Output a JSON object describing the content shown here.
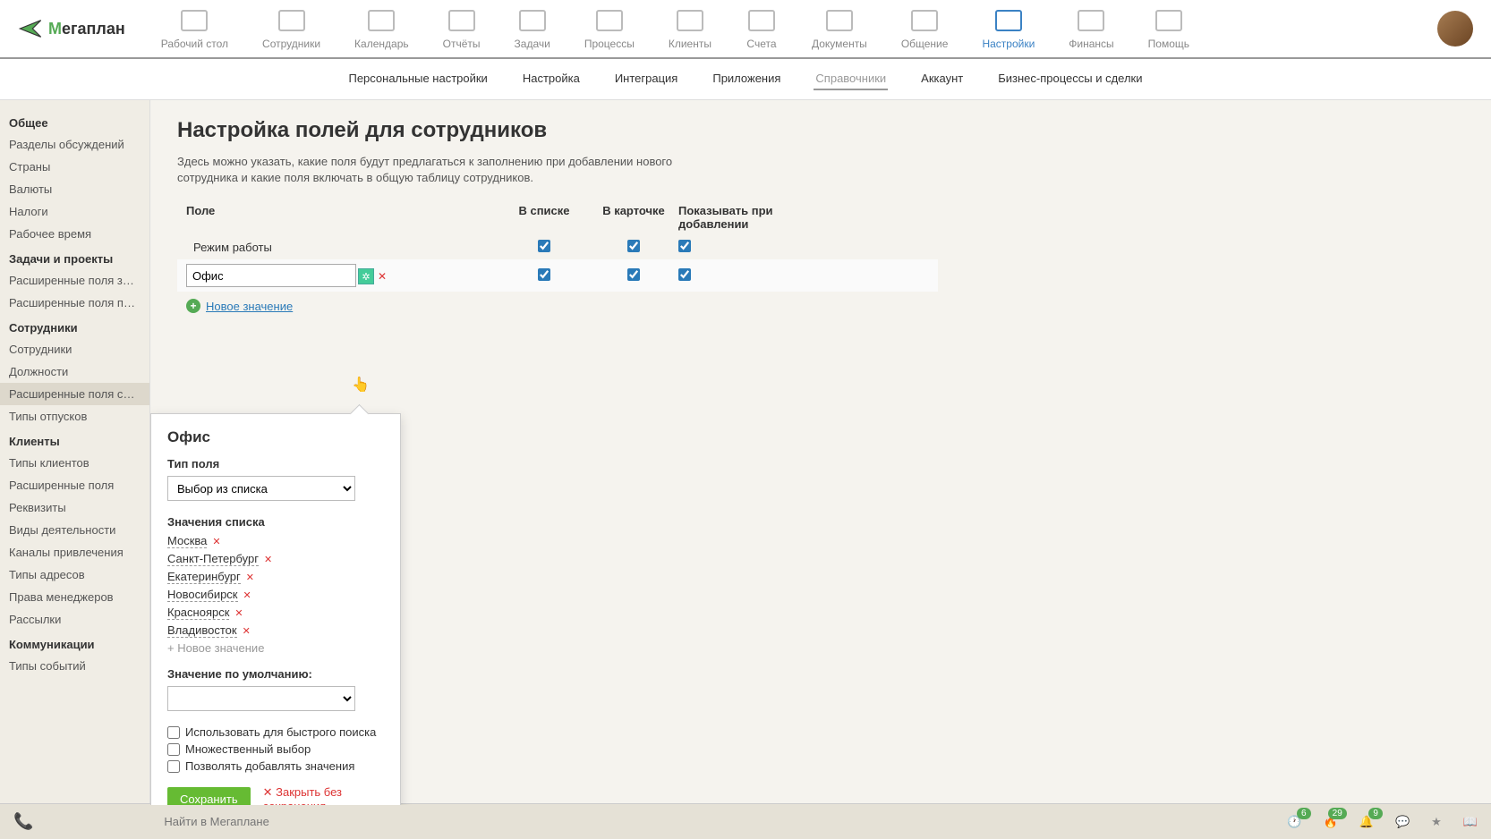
{
  "logo_text": "егаплан",
  "nav": [
    {
      "label": "Рабочий стол"
    },
    {
      "label": "Сотрудники"
    },
    {
      "label": "Календарь"
    },
    {
      "label": "Отчёты"
    },
    {
      "label": "Задачи"
    },
    {
      "label": "Процессы"
    },
    {
      "label": "Клиенты"
    },
    {
      "label": "Счета"
    },
    {
      "label": "Документы"
    },
    {
      "label": "Общение"
    },
    {
      "label": "Настройки",
      "active": true
    },
    {
      "label": "Финансы"
    },
    {
      "label": "Помощь"
    }
  ],
  "subtabs": [
    {
      "label": "Персональные настройки"
    },
    {
      "label": "Настройка"
    },
    {
      "label": "Интеграция"
    },
    {
      "label": "Приложения"
    },
    {
      "label": "Справочники",
      "active": true
    },
    {
      "label": "Аккаунт"
    },
    {
      "label": "Бизнес-процессы и сделки"
    }
  ],
  "sidebar": {
    "sections": [
      {
        "title": "Общее",
        "items": [
          "Разделы обсуждений",
          "Страны",
          "Валюты",
          "Налоги",
          "Рабочее время"
        ]
      },
      {
        "title": "Задачи и проекты",
        "items": [
          "Расширенные поля задач",
          "Расширенные поля проек..."
        ]
      },
      {
        "title": "Сотрудники",
        "items": [
          "Сотрудники",
          "Должности",
          "Расширенные поля сотру...",
          "Типы отпусков"
        ]
      },
      {
        "title": "Клиенты",
        "items": [
          "Типы клиентов",
          "Расширенные поля",
          "Реквизиты",
          "Виды деятельности",
          "Каналы привлечения",
          "Типы адресов",
          "Права менеджеров",
          "Рассылки"
        ]
      },
      {
        "title": "Коммуникации",
        "items": [
          "Типы событий"
        ]
      }
    ],
    "active": "Расширенные поля сотру..."
  },
  "page": {
    "title": "Настройка полей для сотрудников",
    "desc": "Здесь можно указать, какие поля будут предлагаться к заполнению при добавлении нового сотрудника и какие поля включать в общую таблицу сотрудников."
  },
  "table": {
    "headers": {
      "name": "Поле",
      "list": "В списке",
      "card": "В карточке",
      "add": "Показывать при добавлении"
    },
    "rows": [
      {
        "name": "Режим работы",
        "list": true,
        "card": true,
        "add": true,
        "editing": false
      },
      {
        "name": "Офис",
        "list": true,
        "card": true,
        "add": true,
        "editing": true
      }
    ],
    "add_link": "Новое значение"
  },
  "popover": {
    "title": "Офис",
    "type_label": "Тип поля",
    "type_value": "Выбор из списка",
    "values_label": "Значения списка",
    "values": [
      "Москва",
      "Санкт-Петербург",
      "Екатеринбург",
      "Новосибирск",
      "Красноярск",
      "Владивосток"
    ],
    "new_value": "Новое значение",
    "default_label": "Значение по умолчанию:",
    "checkboxes": [
      "Использовать для быстрого поиска",
      "Множественный выбор",
      "Позволять добавлять значения"
    ],
    "save": "Сохранить",
    "cancel": "Закрыть без сохранения"
  },
  "bottom": {
    "search_placeholder": "Найти в Мегаплане",
    "badges": {
      "clock": "6",
      "fire": "29",
      "bell": "9"
    }
  }
}
